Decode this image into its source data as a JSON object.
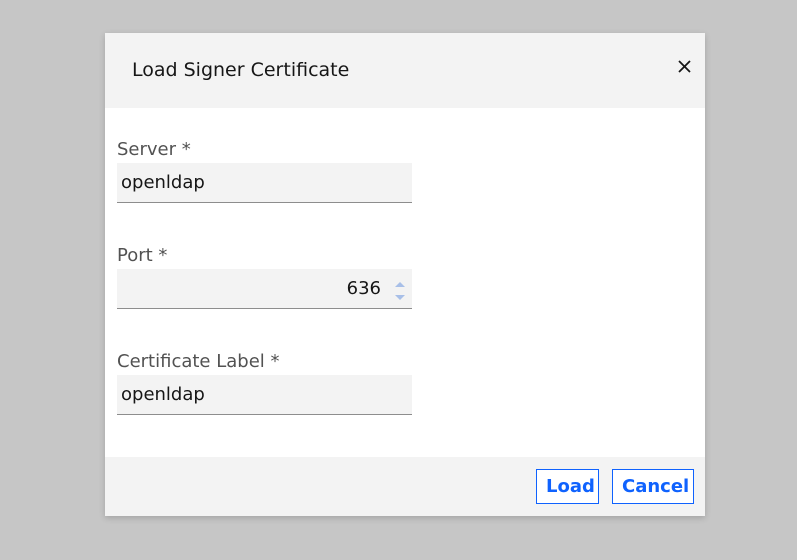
{
  "dialog": {
    "title": "Load Signer Certificate",
    "close_icon": "close-icon"
  },
  "form": {
    "server": {
      "label": "Server *",
      "value": "openldap"
    },
    "port": {
      "label": "Port *",
      "value": "636",
      "increment_icon": "chevron-up-icon",
      "decrement_icon": "chevron-down-icon"
    },
    "certificate_label": {
      "label": "Certificate Label *",
      "value": "openldap"
    }
  },
  "footer": {
    "load_label": "Load",
    "cancel_label": "Cancel"
  },
  "colors": {
    "accent": "#0f62fe",
    "backdrop": "#c6c6c6",
    "surface": "#f3f3f3"
  }
}
